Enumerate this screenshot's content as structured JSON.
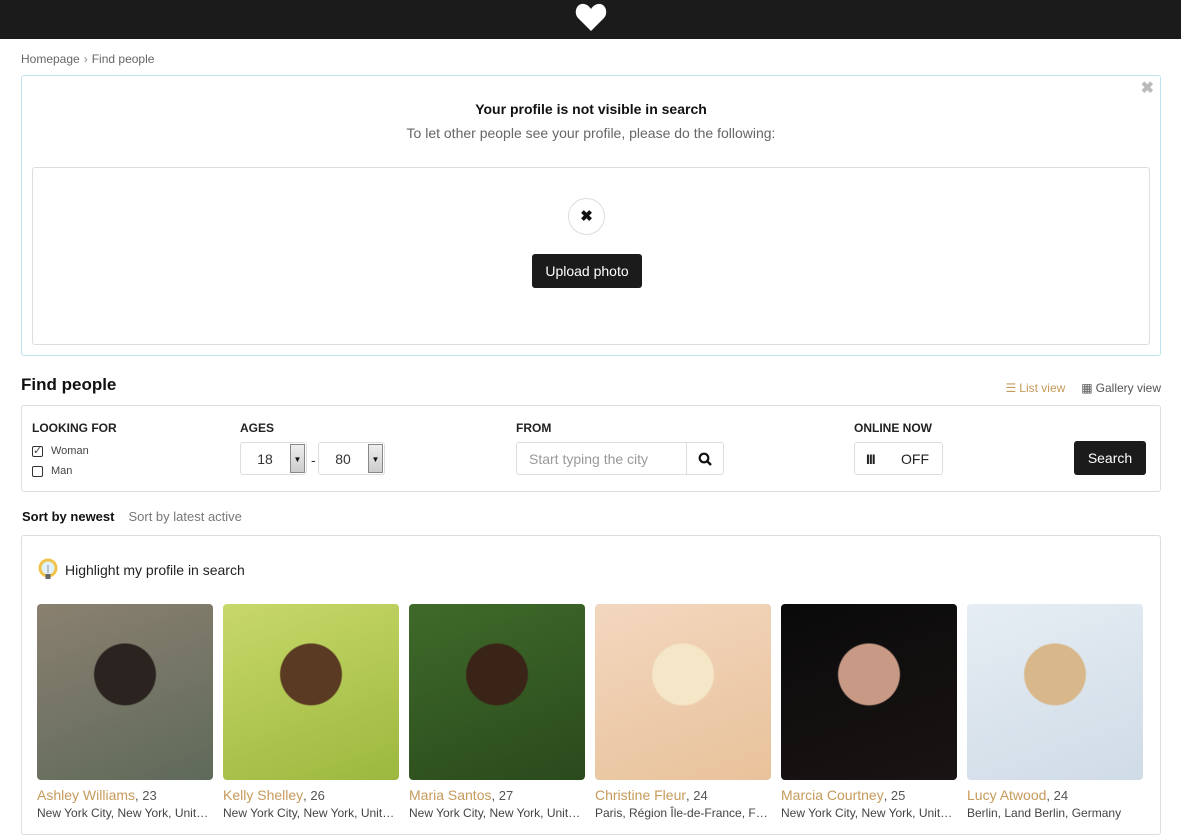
{
  "header": {
    "logo_icon": "heart-icon"
  },
  "breadcrumb": {
    "items": [
      "Homepage",
      "Find people"
    ],
    "separator": "›"
  },
  "notice": {
    "title": "Your profile is not visible in search",
    "subtitle": "To let other people see your profile, please do the following:",
    "close_icon": "close-icon",
    "status_icon": "x-mark-icon",
    "upload_label": "Upload photo"
  },
  "find": {
    "title": "Find people",
    "list_view": "List view",
    "gallery_view": "Gallery view"
  },
  "filters": {
    "looking_for_label": "Looking for",
    "options": [
      {
        "label": "Woman",
        "checked": true
      },
      {
        "label": "Man",
        "checked": false
      }
    ],
    "ages_label": "Ages",
    "age_min": "18",
    "age_max": "80",
    "age_separator": "-",
    "from_label": "From",
    "city_placeholder": "Start typing the city",
    "city_value": "",
    "online_label": "Online now",
    "online_bars": "III",
    "online_state": "OFF",
    "search_label": "Search"
  },
  "sort": {
    "newest": "Sort by newest",
    "latest_active": "Sort by latest active",
    "active": "newest"
  },
  "results": {
    "highlight_label": "Highlight my profile in search",
    "people": [
      {
        "name": "Ashley Williams",
        "age": ", 23",
        "location": "New York City, New York, United States",
        "photo_colors": [
          "#8a8070",
          "#5f6a5a",
          "#2a2320"
        ]
      },
      {
        "name": "Kelly Shelley",
        "age": ", 26",
        "location": "New York City, New York, United States",
        "photo_colors": [
          "#c8d86a",
          "#9cb83e",
          "#5a3a22"
        ]
      },
      {
        "name": "Maria Santos",
        "age": ", 27",
        "location": "New York City, New York, United States",
        "photo_colors": [
          "#3f6a2a",
          "#2a4a1c",
          "#3a2418"
        ]
      },
      {
        "name": "Christine Fleur",
        "age": ", 24",
        "location": "Paris, Région Île-de-France, France",
        "photo_colors": [
          "#f3d7bf",
          "#e8c29a",
          "#f5e6c8"
        ]
      },
      {
        "name": "Marcia Courtney",
        "age": ", 25",
        "location": "New York City, New York, United States",
        "photo_colors": [
          "#0a0a0a",
          "#1a1414",
          "#c89a86"
        ]
      },
      {
        "name": "Lucy Atwood",
        "age": ", 24",
        "location": "Berlin, Land Berlin, Germany",
        "photo_colors": [
          "#e6edf4",
          "#cfdbe6",
          "#d8b88a"
        ]
      }
    ]
  },
  "colors": {
    "accent": "#c69a5a",
    "dark": "#1b1b1b",
    "notice_border": "#bfe3ee"
  }
}
